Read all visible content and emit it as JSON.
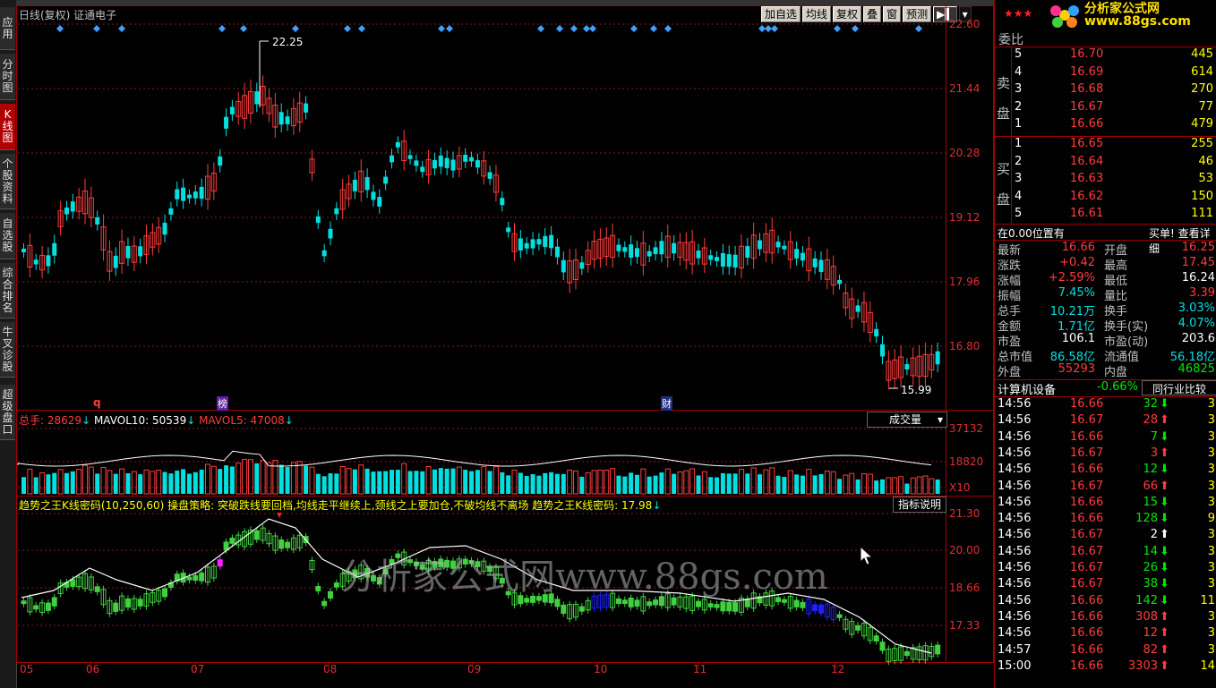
{
  "left_tabs": [
    {
      "label": "应用",
      "active": false
    },
    {
      "label": "分时图",
      "active": false
    },
    {
      "label": "K线图",
      "active": true
    },
    {
      "label": "个股资料",
      "active": false
    },
    {
      "label": "自选股",
      "active": false
    },
    {
      "label": "综合排名",
      "active": false
    },
    {
      "label": "牛叉诊股",
      "active": false
    },
    {
      "label": "超级盘口",
      "active": false
    }
  ],
  "chart": {
    "title": "日线(复权) 证通电子",
    "toolbar": [
      "加自选",
      "均线",
      "复权",
      "叠",
      "窗",
      "预测"
    ],
    "price_axis": [
      "22.60",
      "21.44",
      "20.28",
      "19.12",
      "17.96",
      "16.80"
    ],
    "high_label": "22.25",
    "low_label": "15.99",
    "markers": [
      "q",
      "榜",
      "财"
    ],
    "volume": {
      "legend": {
        "total_label": "总手:",
        "total_value": "28629",
        "ma10_label": "MAVOL10:",
        "ma10_value": "50539",
        "ma5_label": "MAVOL5:",
        "ma5_value": "47008"
      },
      "selector": "成交量",
      "axis": [
        "37132",
        "18820",
        "X10"
      ]
    },
    "indicator": {
      "legend": "趋势之王K线密码(10,250,60) 操盘策略: 突破跌线要回档,均线走平继续上,颈线之上要加仓,不破均线不离场 趋势之王K线密码: 17.98",
      "help_button": "指标说明",
      "axis": [
        "21.30",
        "20.00",
        "18.66",
        "17.33"
      ]
    },
    "x_axis": [
      "05",
      "06",
      "07",
      "08",
      "09",
      "10",
      "11",
      "12"
    ],
    "watermark": "分析家公式网www.88gs.com",
    "logo": "分析家公式网 www.88gs.com"
  },
  "quote": {
    "weibi_label": "委比",
    "sell_label": [
      "卖",
      "盘"
    ],
    "buy_label": [
      "买",
      "盘"
    ],
    "sell": [
      {
        "level": "5",
        "price": "16.70",
        "vol": "445"
      },
      {
        "level": "4",
        "price": "16.69",
        "vol": "614"
      },
      {
        "level": "3",
        "price": "16.68",
        "vol": "270"
      },
      {
        "level": "2",
        "price": "16.67",
        "vol": "77"
      },
      {
        "level": "1",
        "price": "16.66",
        "vol": "479"
      }
    ],
    "buy": [
      {
        "level": "1",
        "price": "16.65",
        "vol": "255"
      },
      {
        "level": "2",
        "price": "16.64",
        "vol": "46"
      },
      {
        "level": "3",
        "price": "16.63",
        "vol": "53"
      },
      {
        "level": "4",
        "price": "16.62",
        "vol": "150"
      },
      {
        "level": "5",
        "price": "16.61",
        "vol": "111"
      }
    ],
    "position_left": "在0.00位置有",
    "position_right": "买单! 查看详细",
    "stats": [
      {
        "l1": "最新",
        "v1": "16.66",
        "c1": "red",
        "l2": "开盘",
        "v2": "16.25",
        "c2": "red"
      },
      {
        "l1": "涨跌",
        "v1": "+0.42",
        "c1": "red",
        "l2": "最高",
        "v2": "17.45",
        "c2": "red"
      },
      {
        "l1": "涨幅",
        "v1": "+2.59%",
        "c1": "red",
        "l2": "最低",
        "v2": "16.24",
        "c2": "white"
      },
      {
        "l1": "振幅",
        "v1": "7.45%",
        "c1": "cyan",
        "l2": "量比",
        "v2": "3.39",
        "c2": "red"
      },
      {
        "l1": "总手",
        "v1": "10.21万",
        "c1": "cyan",
        "l2": "换手",
        "v2": "3.03%",
        "c2": "cyan"
      },
      {
        "l1": "金额",
        "v1": "1.71亿",
        "c1": "cyan",
        "l2": "换手(实)",
        "v2": "4.07%",
        "c2": "cyan"
      },
      {
        "l1": "市盈",
        "v1": "106.1",
        "c1": "white",
        "l2": "市盈(动)",
        "v2": "203.6",
        "c2": "white"
      },
      {
        "l1": "总市值",
        "v1": "86.58亿",
        "c1": "cyan",
        "l2": "流通值",
        "v2": "56.18亿",
        "c2": "cyan"
      },
      {
        "l1": "外盘",
        "v1": "55293",
        "c1": "red",
        "l2": "内盘",
        "v2": "46825",
        "c2": "green"
      }
    ],
    "industry": {
      "name": "计算机设备",
      "change": "-0.66%",
      "compare": "同行业比较"
    },
    "ticks": [
      {
        "time": "14:56",
        "price": "16.66",
        "vol": "32",
        "dir": "down",
        "extra": "3"
      },
      {
        "time": "14:56",
        "price": "16.67",
        "vol": "28",
        "dir": "up",
        "extra": "3"
      },
      {
        "time": "14:56",
        "price": "16.66",
        "vol": "7",
        "dir": "down",
        "extra": "3"
      },
      {
        "time": "14:56",
        "price": "16.67",
        "vol": "3",
        "dir": "up",
        "extra": "3"
      },
      {
        "time": "14:56",
        "price": "16.66",
        "vol": "12",
        "dir": "down",
        "extra": "3"
      },
      {
        "time": "14:56",
        "price": "16.67",
        "vol": "66",
        "dir": "up",
        "extra": "3"
      },
      {
        "time": "14:56",
        "price": "16.66",
        "vol": "15",
        "dir": "down",
        "extra": "3"
      },
      {
        "time": "14:56",
        "price": "16.66",
        "vol": "128",
        "dir": "down",
        "extra": "9"
      },
      {
        "time": "14:56",
        "price": "16.67",
        "vol": "2",
        "dir": "neutral",
        "extra": "3"
      },
      {
        "time": "14:56",
        "price": "16.67",
        "vol": "14",
        "dir": "down",
        "extra": "3"
      },
      {
        "time": "14:56",
        "price": "16.67",
        "vol": "26",
        "dir": "down",
        "extra": "3"
      },
      {
        "time": "14:56",
        "price": "16.67",
        "vol": "38",
        "dir": "down",
        "extra": "3"
      },
      {
        "time": "14:56",
        "price": "16.66",
        "vol": "142",
        "dir": "down",
        "extra": "11"
      },
      {
        "time": "14:56",
        "price": "16.66",
        "vol": "308",
        "dir": "up",
        "extra": "3"
      },
      {
        "time": "14:56",
        "price": "16.66",
        "vol": "12",
        "dir": "up",
        "extra": "3"
      },
      {
        "time": "14:57",
        "price": "16.66",
        "vol": "82",
        "dir": "up",
        "extra": "3"
      },
      {
        "time": "15:00",
        "price": "16.66",
        "vol": "3303",
        "dir": "up",
        "extra": "14"
      }
    ]
  },
  "colors": {
    "up": "#ff3c3c",
    "down": "#00e0e0",
    "border": "#a00000"
  }
}
